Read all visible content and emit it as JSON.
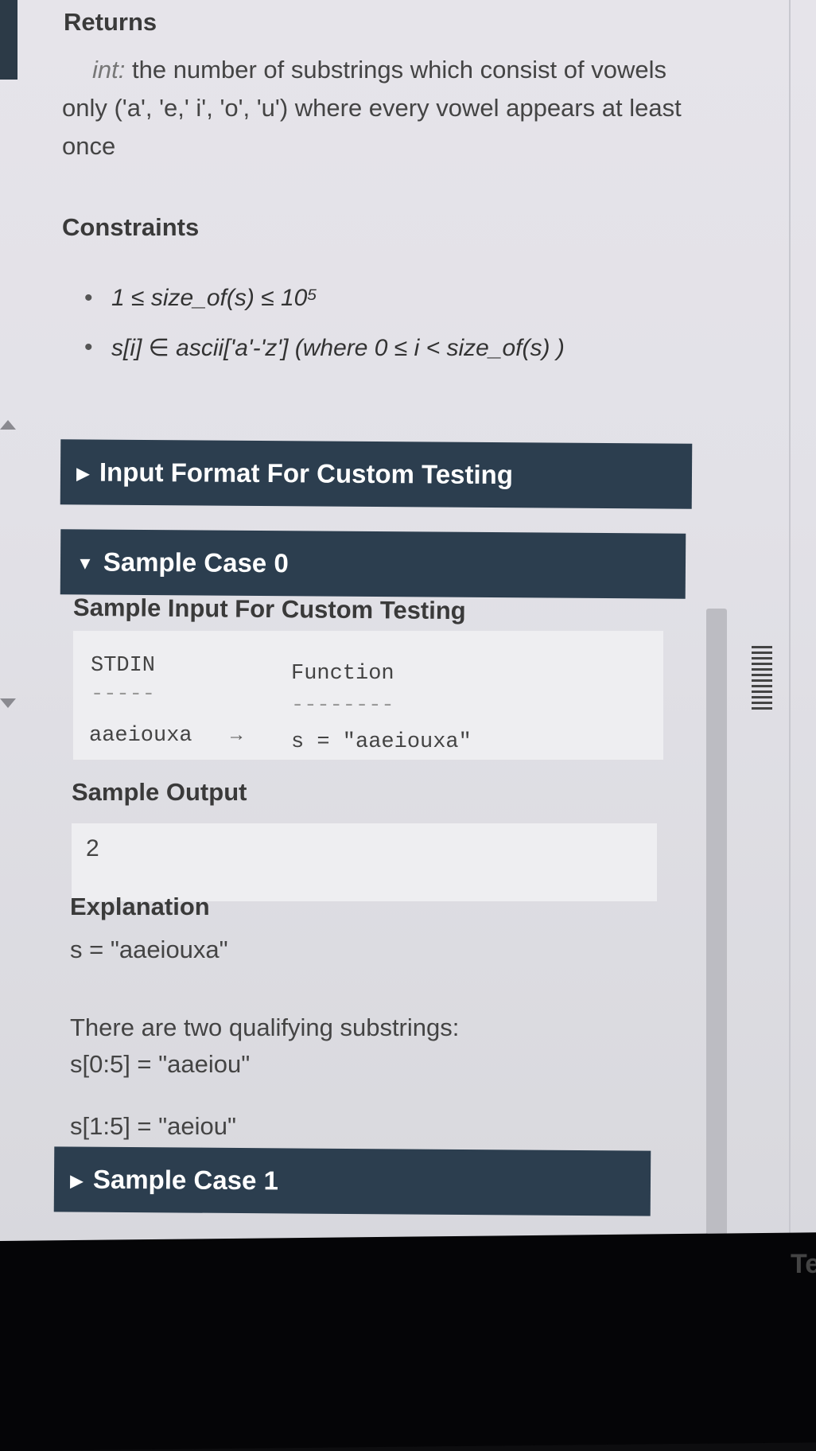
{
  "returns": {
    "heading": "Returns",
    "type_label": "int:",
    "description": "the number of substrings which consist of vowels only ('a', 'e,' i', 'o', 'u') where every vowel appears at least once"
  },
  "constraints": {
    "heading": "Constraints",
    "items": [
      "1 ≤ size_of(s) ≤ 10⁵",
      "s[i] ∈ ascii['a'-'z'] (where 0 ≤ i < size_of(s) )"
    ]
  },
  "sections": {
    "input_format": "Input Format For Custom Testing",
    "sample_case_0": "Sample Case 0",
    "sample_case_1": "Sample Case 1"
  },
  "sample_input": {
    "heading": "Sample Input For Custom Testing",
    "col1_header": "STDIN",
    "col1_rule": "-----",
    "col2_header": "Function",
    "col2_rule": "--------",
    "row_stdin": "aaeiouxa",
    "arrow": "→",
    "row_function": "s = \"aaeiouxa\""
  },
  "sample_output": {
    "heading": "Sample Output",
    "value": "2"
  },
  "explanation": {
    "heading": "Explanation",
    "line1": "s = \"aaeiouxa\"",
    "line2": "There are two qualifying substrings:",
    "line3": "s[0:5] = \"aaeiou\"",
    "line4": "s[1:5] = \"aeiou\""
  },
  "edge_text": "Te"
}
